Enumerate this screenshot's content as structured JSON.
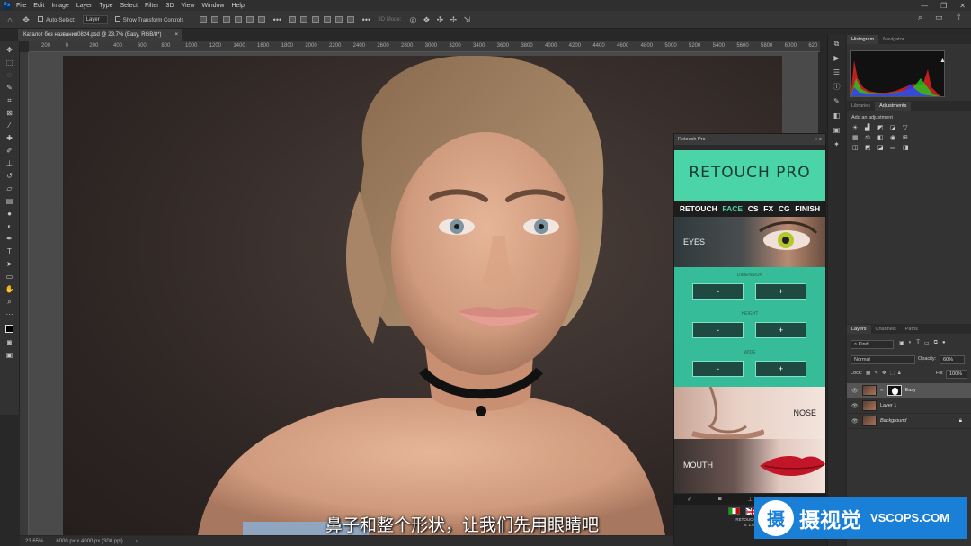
{
  "app": {
    "logo_text": "Ps"
  },
  "menu": [
    "File",
    "Edit",
    "Image",
    "Layer",
    "Type",
    "Select",
    "Filter",
    "3D",
    "View",
    "Window",
    "Help"
  ],
  "options_bar": {
    "auto_select_label": "Auto-Select:",
    "auto_select_target": "Layer",
    "transform_label": "Show Transform Controls",
    "mode_3d_label": "3D Mode:"
  },
  "document": {
    "tab_title": "Каталог без названия0824.psd @ 23.7% (Easy, RGB/8*)",
    "close": "×"
  },
  "ruler_ticks": [
    "200",
    "0",
    "200",
    "400",
    "600",
    "800",
    "1000",
    "1200",
    "1400",
    "1600",
    "1800",
    "2000",
    "2200",
    "2400",
    "2600",
    "2800",
    "3000",
    "3200",
    "3400",
    "3600",
    "3800",
    "4000",
    "4200",
    "4400",
    "4600",
    "4800",
    "5000",
    "5200",
    "5400",
    "5600",
    "5800",
    "6000",
    "620"
  ],
  "status": {
    "zoom": "23.65%",
    "doc_size": "6000 px x 4000 px (300 ppi)"
  },
  "panels": {
    "histogram_tabs": [
      "Histogram",
      "Navigator"
    ],
    "adjust_tabs": [
      "Libraries",
      "Adjustments"
    ],
    "add_adjustment": "Add an adjustment",
    "layers_tabs": [
      "Layers",
      "Channels",
      "Paths"
    ],
    "kind_label": "Kind",
    "blend_mode": "Normal",
    "opacity_label": "Opacity:",
    "opacity_value": "60%",
    "lock_label": "Lock:",
    "fill_label": "Fill:",
    "fill_value": "100%",
    "layers": [
      {
        "name": "Easy"
      },
      {
        "name": "Layer 1"
      },
      {
        "name": "Background"
      }
    ]
  },
  "retouch_pro": {
    "panel_title": "Retouch Pro",
    "logo": "RETOUCH PRO",
    "nav": [
      "RETOUCH",
      "FACE",
      "CS",
      "FX",
      "CG",
      "FINISH"
    ],
    "active_nav": "FACE",
    "eyes_label": "EYES",
    "controls": [
      {
        "label": "DIMENSION",
        "minus": "-",
        "plus": "+"
      },
      {
        "label": "HEIGHT",
        "minus": "-",
        "plus": "+"
      },
      {
        "label": "WIDE",
        "minus": "-",
        "plus": "+"
      }
    ],
    "nose_label": "NOSE",
    "mouth_label": "MOUTH",
    "version_name": "RETOUCH PRO",
    "version": "V. 1.0.0"
  },
  "subtitle": "鼻子和整个形状，让我们先用眼睛吧",
  "watermark": {
    "cn": "摄视觉",
    "en": "VSCOPS.COM",
    "icon": "摄"
  },
  "colors": {
    "accent_teal": "#4ad4a8",
    "watermark_blue": "#1a7fd6"
  }
}
